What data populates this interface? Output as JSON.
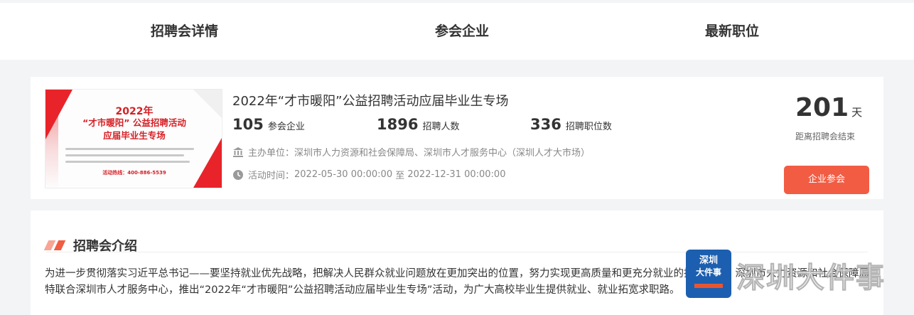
{
  "tabs": [
    {
      "label": "招聘会详情"
    },
    {
      "label": "参会企业"
    },
    {
      "label": "最新职位"
    }
  ],
  "event": {
    "title": "2022年“才市暖阳”公益招聘活动应届毕业生专场",
    "poster": {
      "year": "2022年",
      "title_line1": "“才市暖阳” 公益招聘活动",
      "title_line2": "应届毕业生专场",
      "hotline": "活动热线：400-886-5539"
    },
    "stats": [
      {
        "value": "105",
        "label": "参会企业"
      },
      {
        "value": "1896",
        "label": "招聘人数"
      },
      {
        "value": "336",
        "label": "招聘职位数"
      }
    ],
    "organizer_label": "主办单位：",
    "organizer": "深圳市人力资源和社会保障局、深圳市人才服务中心（深圳人才大市场）",
    "time_label": "活动时间：",
    "time_start": "2022-05-30 00:00:00",
    "time_sep": "至",
    "time_end": "2022-12-31 00:00:00",
    "days_left": "201",
    "days_unit": "天",
    "days_label": "距离招聘会结束",
    "join_button": "企业参会"
  },
  "intro": {
    "title": "招聘会介绍",
    "text": "为进一步贯彻落实习近平总书记——要坚持就业优先战略，把解决人民群众就业问题放在更加突出的位置，努力实现更高质量和更充分就业的指导思想，深圳市人力资源和社会保障局特联合深圳市人才服务中心，推出“2022年“才市暖阳”公益招聘活动应届毕业生专场”活动，为广大高校毕业生提供就业、就业拓宽求职路。"
  },
  "watermark": {
    "badge_line1": "深圳",
    "badge_line2": "大件事",
    "text": "深圳大件事"
  },
  "colors": {
    "accent": "#f25c43",
    "poster_red": "#e8242a",
    "badge_blue": "#1c5fb0"
  }
}
